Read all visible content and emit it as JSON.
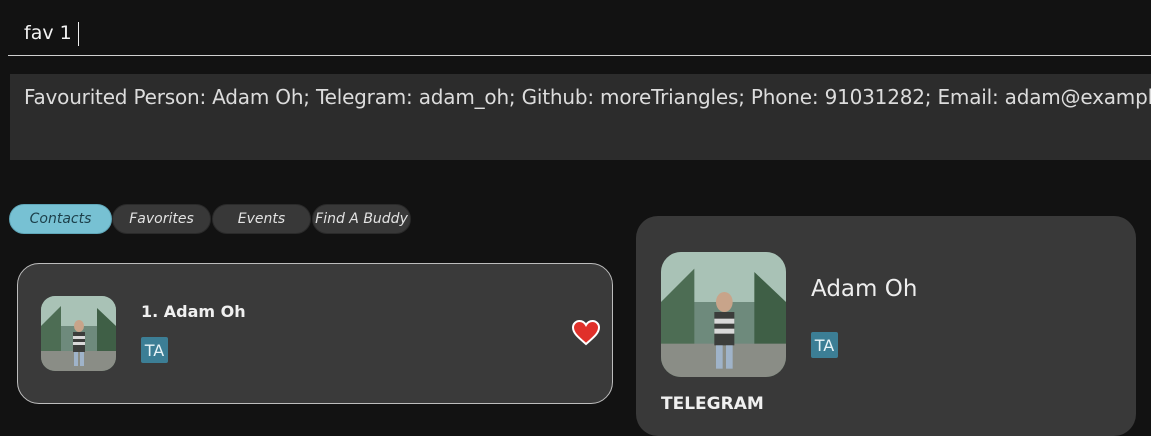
{
  "command": {
    "value": "fav 1",
    "placeholder": ""
  },
  "result": {
    "text": "Favourited Person: Adam Oh; Telegram: adam_oh; Github: moreTriangles; Phone: 91031282; Email: adam@example."
  },
  "tabs": [
    {
      "label": "Contacts",
      "active": true
    },
    {
      "label": "Favorites",
      "active": false
    },
    {
      "label": "Events",
      "active": false
    },
    {
      "label": "Find A Buddy",
      "active": false
    }
  ],
  "list": {
    "items": [
      {
        "name": "1.  Adam Oh",
        "tag": "TA",
        "favourite": true
      }
    ]
  },
  "detail": {
    "name": "Adam Oh",
    "tag": "TA",
    "section_label": "TELEGRAM"
  },
  "colors": {
    "accent_tab": "#77c1d3",
    "tag_bg": "#3c7e95",
    "heart": "#e0302a"
  },
  "icons": {
    "favourite": "heart-icon"
  }
}
